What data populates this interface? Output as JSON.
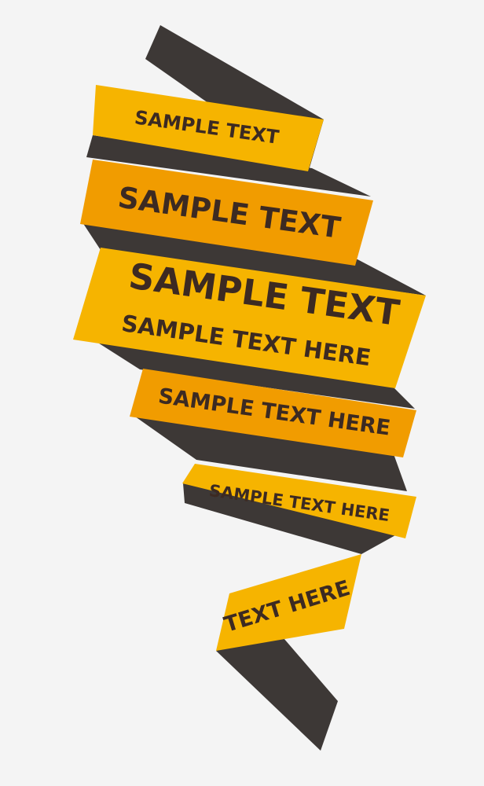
{
  "colors": {
    "background": "#f4f4f4",
    "fold_dark": "#3d3836",
    "ribbon_yellow": "#f6b400",
    "ribbon_orange": "#f19c00",
    "text": "#3c2a22"
  },
  "ribbons": [
    {
      "id": "ribbon-1",
      "lines": [
        "SAMPLE TEXT"
      ]
    },
    {
      "id": "ribbon-2",
      "lines": [
        "SAMPLE TEXT"
      ]
    },
    {
      "id": "ribbon-3",
      "lines": [
        "SAMPLE TEXT",
        "SAMPLE TEXT HERE"
      ]
    },
    {
      "id": "ribbon-4",
      "lines": [
        "SAMPLE TEXT HERE"
      ]
    },
    {
      "id": "ribbon-5",
      "lines": [
        "SAMPLE TEXT HERE"
      ]
    },
    {
      "id": "ribbon-6",
      "lines": [
        "TEXT HERE"
      ]
    }
  ]
}
